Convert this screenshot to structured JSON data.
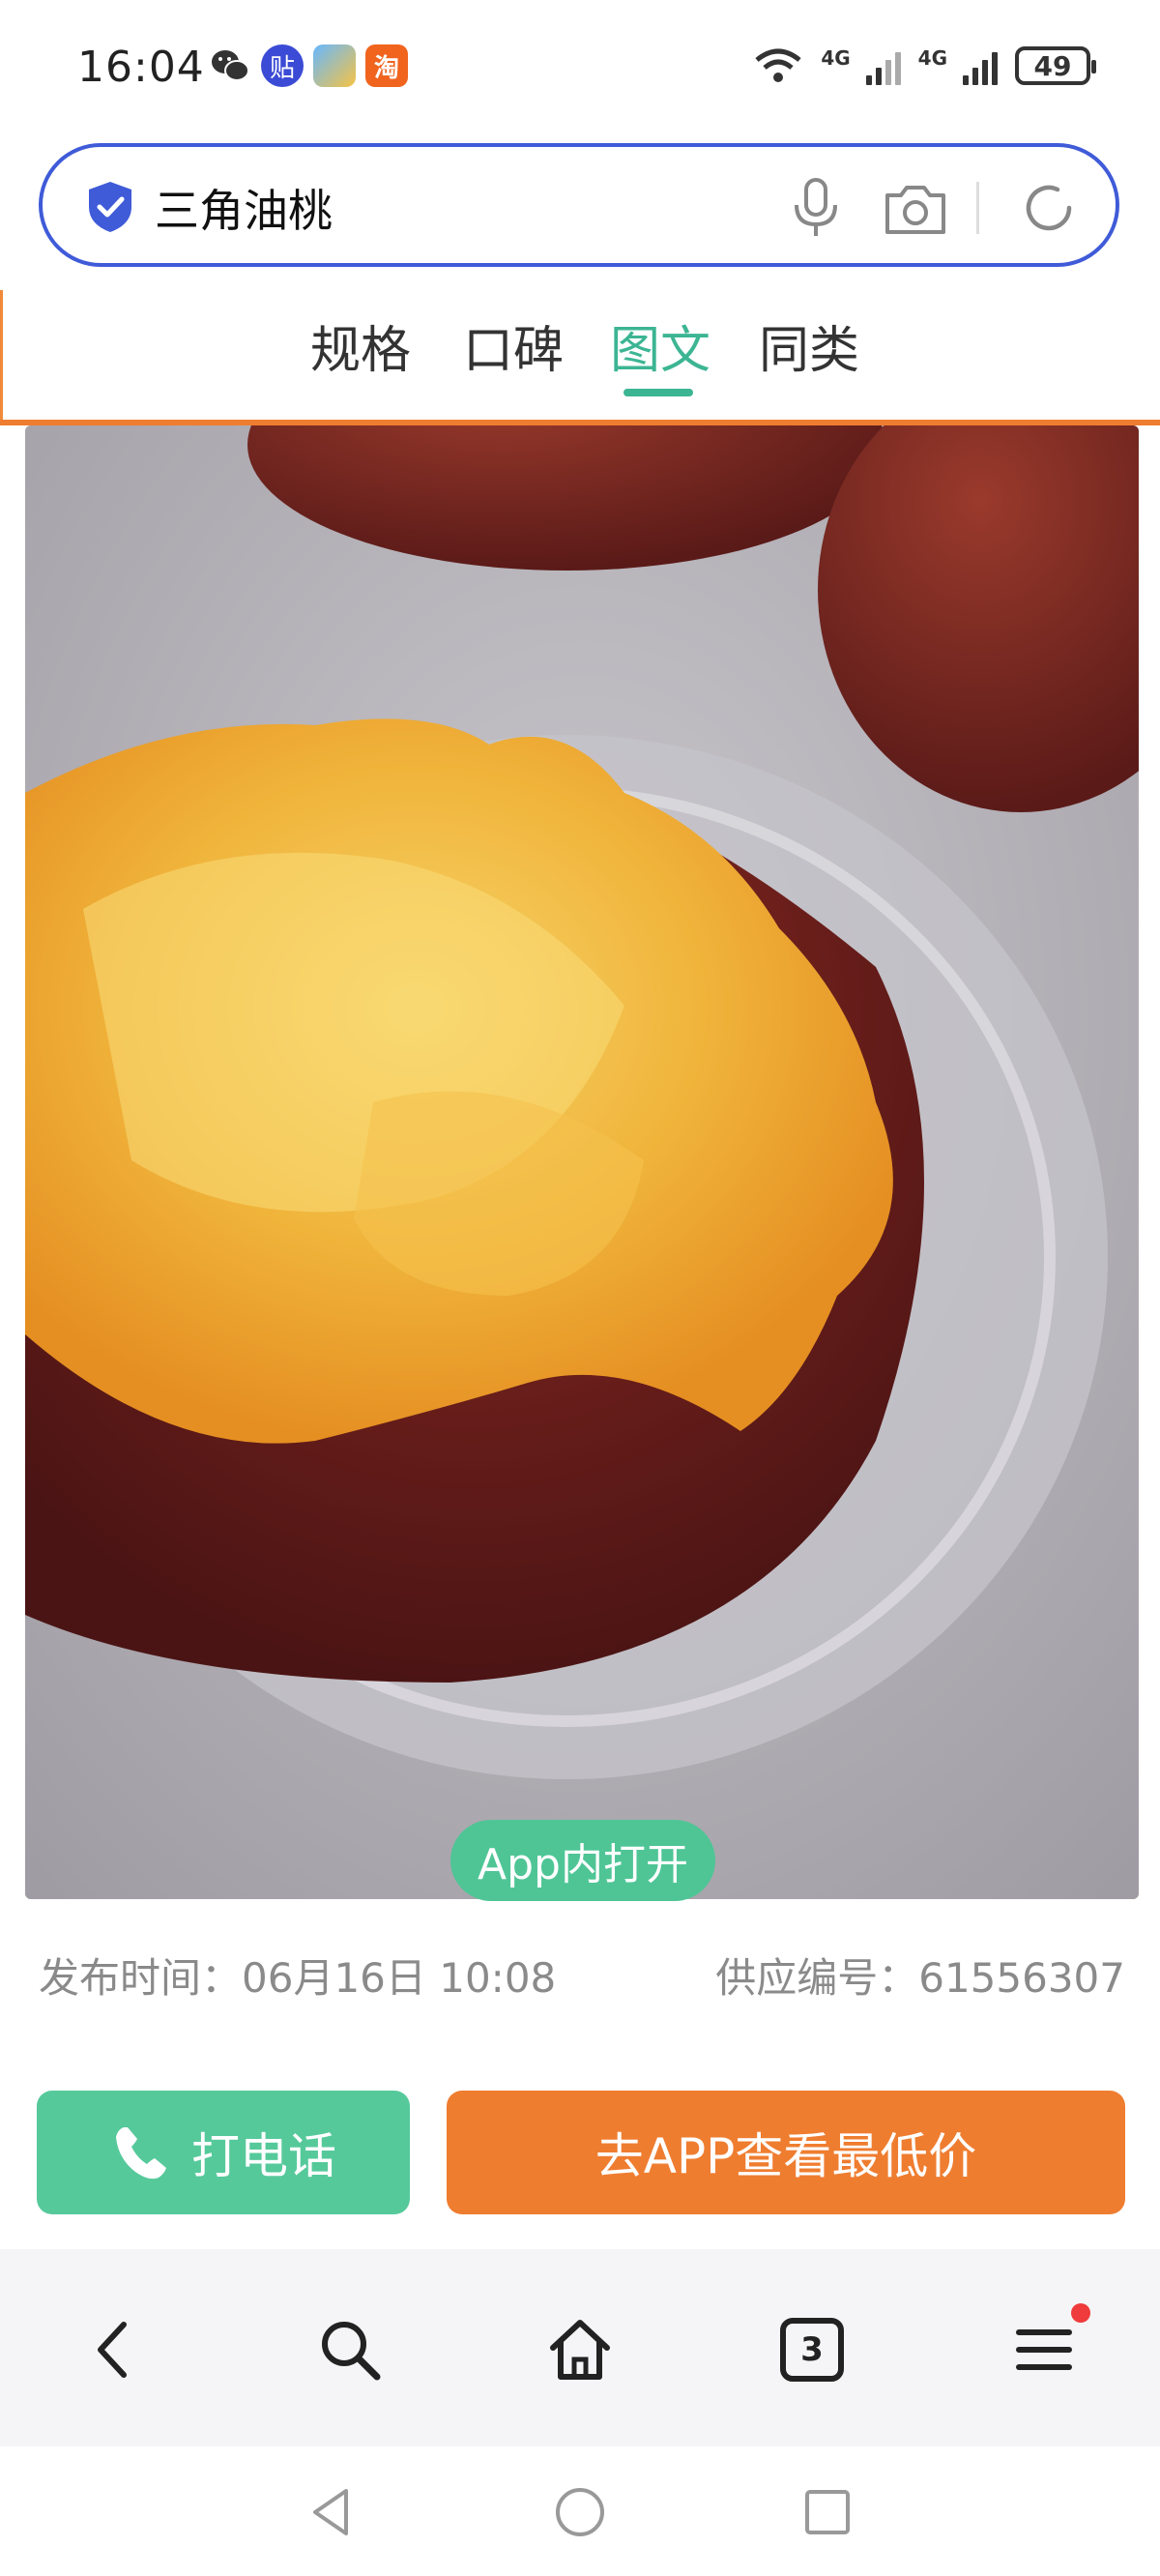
{
  "status_bar": {
    "time": "16:04",
    "apps": [
      "wechat-icon",
      "tieba-icon",
      "weather-icon",
      "taobao-icon"
    ],
    "tieba_label": "贴",
    "taobao_label": "淘",
    "network_1": "4G",
    "network_2": "4G",
    "battery": "49"
  },
  "search": {
    "query": "三角油桃"
  },
  "tabs": [
    {
      "label": "规格",
      "active": false
    },
    {
      "label": "口碑",
      "active": false
    },
    {
      "label": "图文",
      "active": true
    },
    {
      "label": "同类",
      "active": false
    }
  ],
  "product": {
    "open_in_app": "App内打开",
    "publish_time": "发布时间：06月16日 10:08",
    "supply_id": "供应编号：61556307"
  },
  "actions": {
    "call": "打电话",
    "app_lowest_price": "去APP查看最低价"
  },
  "toolbar": {
    "tab_count": "3",
    "icons": [
      "back-icon",
      "search-icon",
      "home-icon",
      "tabs-icon",
      "menu-icon"
    ]
  },
  "colors": {
    "accent_green": "#3cb593",
    "button_green": "#56c99b",
    "accent_orange": "#ef7d30",
    "search_border": "#3f5bd8"
  }
}
